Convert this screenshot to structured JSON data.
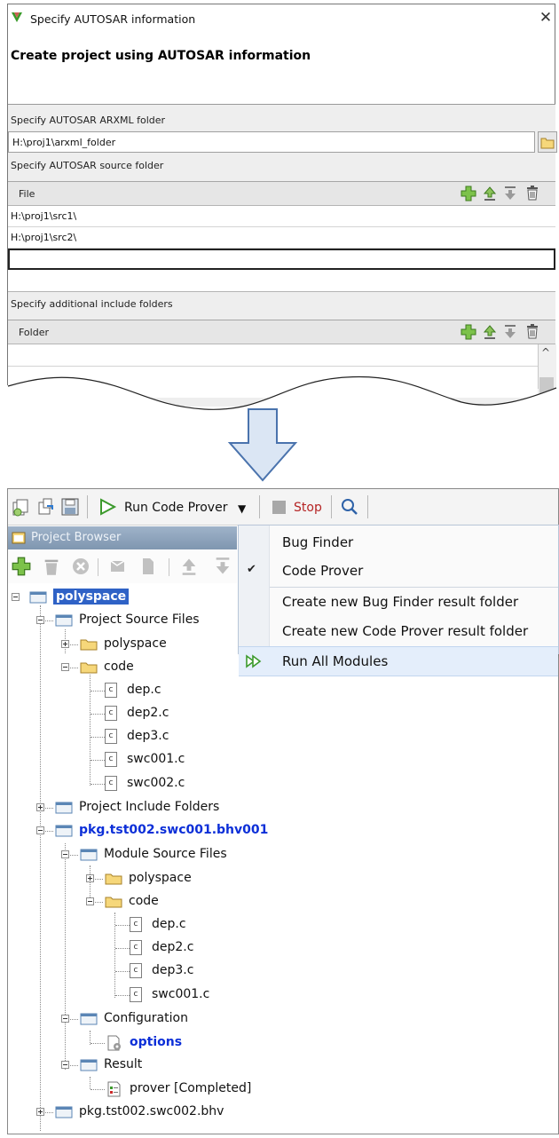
{
  "dialog": {
    "title": "Specify AUTOSAR information",
    "close_glyph": "✕",
    "heading": "Create project using AUTOSAR information",
    "arxml_label": "Specify AUTOSAR ARXML folder",
    "arxml_value": "H:\\proj1\\arxml_folder",
    "source_label": "Specify AUTOSAR source folder",
    "source_table": {
      "header": "File",
      "rows": [
        "H:\\proj1\\src1\\",
        "H:\\proj1\\src2\\",
        ""
      ]
    },
    "include_label": "Specify additional include folders",
    "include_table": {
      "header": "Folder"
    },
    "scroll_up_glyph": "^"
  },
  "toolbar": {
    "run_label": "Run Code Prover",
    "dropdown_glyph": "▼",
    "stop_label": "Stop"
  },
  "project_browser": {
    "title": "Project Browser",
    "tree": {
      "root": "polyspace",
      "project_source_files": "Project Source Files",
      "ps_polyspace": "polyspace",
      "ps_code": "code",
      "ps_files": [
        "dep.c",
        "dep2.c",
        "dep3.c",
        "swc001.c",
        "swc002.c"
      ],
      "project_include_folders": "Project Include Folders",
      "module1": "pkg.tst002.swc001.bhv001",
      "module_source_files": "Module Source Files",
      "ms_polyspace": "polyspace",
      "ms_code": "code",
      "ms_files": [
        "dep.c",
        "dep2.c",
        "dep3.c",
        "swc001.c"
      ],
      "configuration": "Configuration",
      "options": "options",
      "result": "Result",
      "prover": "prover [Completed]",
      "module2": "pkg.tst002.swc002.bhv"
    },
    "file_glyph": "c"
  },
  "run_menu": {
    "items": [
      "Bug Finder",
      "Code Prover",
      "Create new Bug Finder result folder",
      "Create new Code Prover result folder",
      "Run All Modules"
    ],
    "checked_glyph": "✔"
  },
  "colors": {
    "selection": "#2f62c6",
    "module_blue": "#0c2fd8",
    "arrow_fill": "#dbe6f4",
    "arrow_stroke": "#4a73ad"
  }
}
